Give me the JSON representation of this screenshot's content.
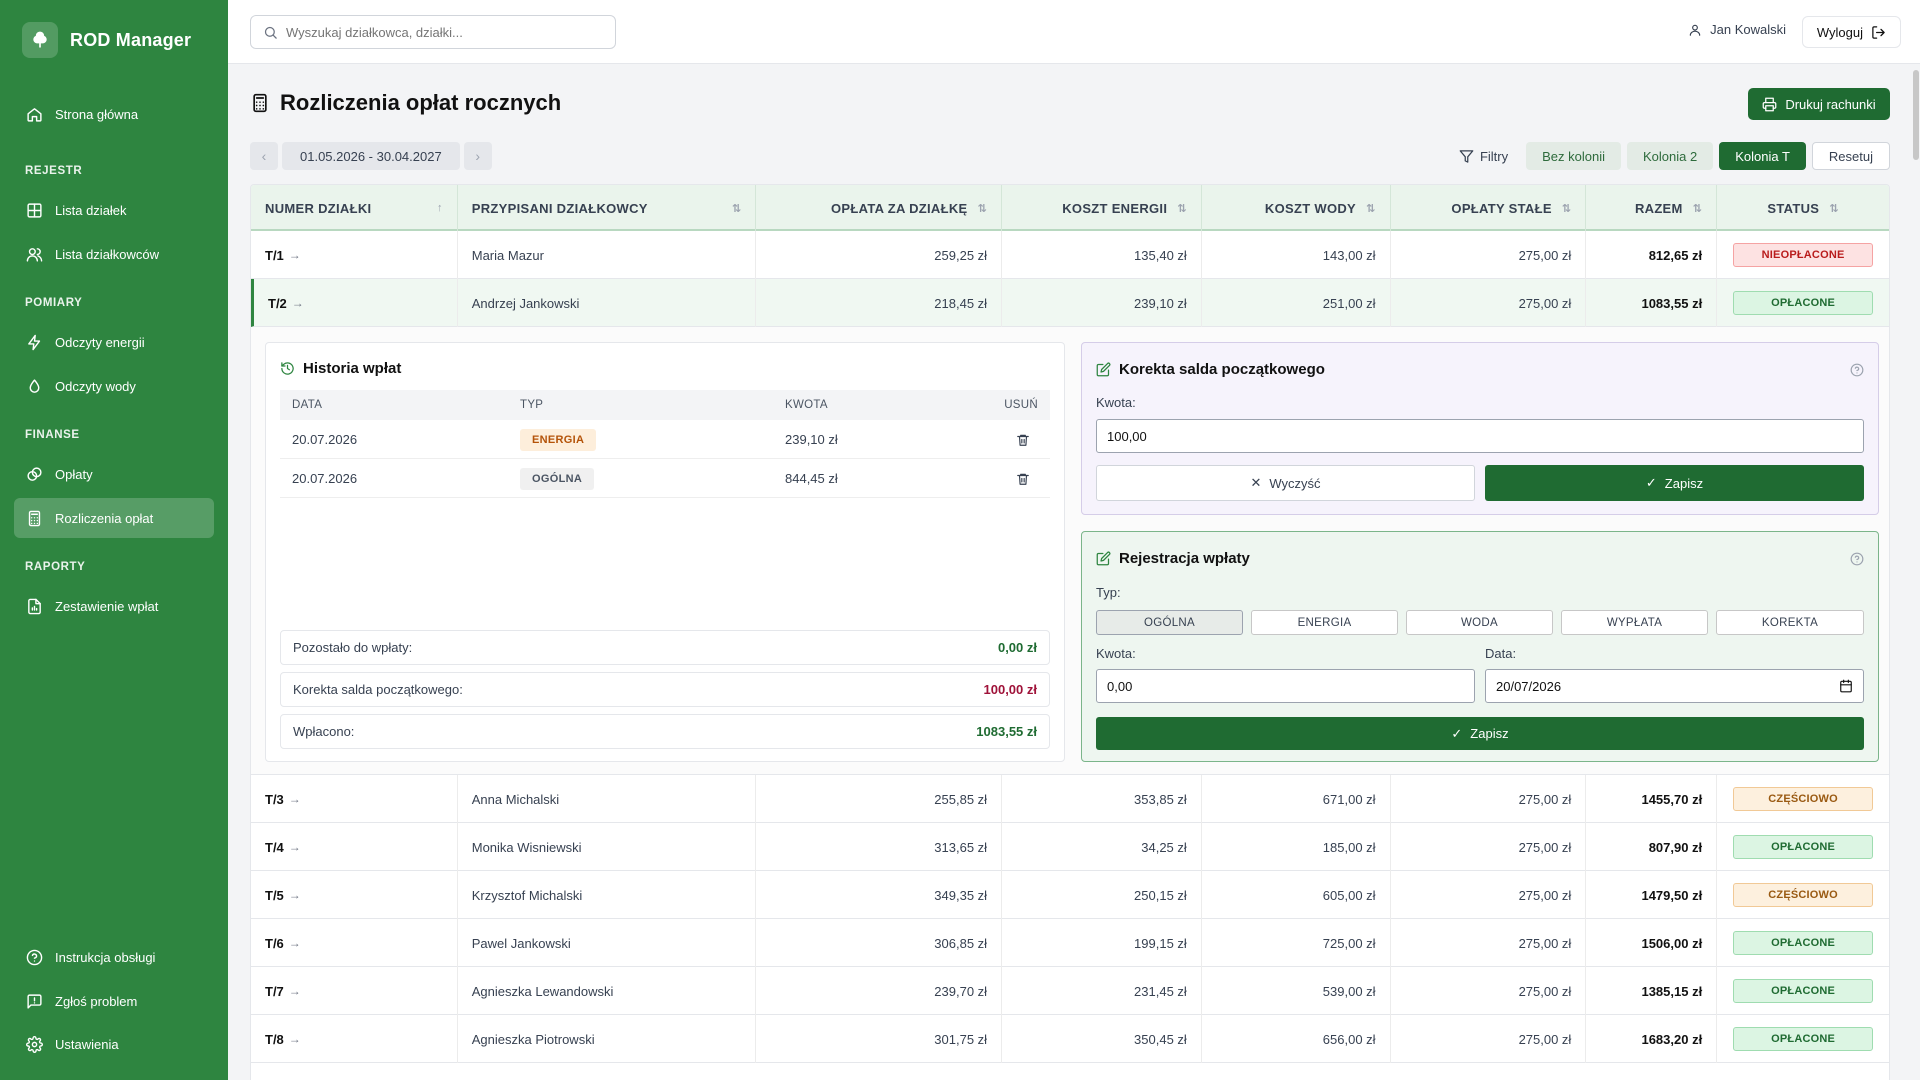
{
  "app": {
    "name": "ROD Manager"
  },
  "sidebar": {
    "home": "Strona główna",
    "sections": {
      "rejestr": "REJESTR",
      "pomiary": "POMIARY",
      "finanse": "FINANSE",
      "raporty": "RAPORTY"
    },
    "items": {
      "plots": "Lista działek",
      "members": "Lista działkowców",
      "energy": "Odczyty energii",
      "water": "Odczyty wody",
      "fees": "Opłaty",
      "settlements": "Rozliczenia opłat",
      "payments_report": "Zestawienie wpłat",
      "manual": "Instrukcja obsługi",
      "report_problem": "Zgłoś problem",
      "settings": "Ustawienia"
    }
  },
  "topbar": {
    "search_placeholder": "Wyszukaj działkowca, działki...",
    "user": "Jan Kowalski",
    "logout": "Wyloguj"
  },
  "page": {
    "title": "Rozliczenia opłat rocznych",
    "print_button": "Drukuj rachunki",
    "period": "01.05.2026 - 30.04.2027",
    "filters_label": "Filtry",
    "filter_chips": [
      "Bez kolonii",
      "Kolonia 2",
      "Kolonia T"
    ],
    "active_chip": "Kolonia T",
    "reset": "Resetuj"
  },
  "table": {
    "columns": [
      "NUMER DZIAŁKI",
      "PRZYPISANI DZIAŁKOWCY",
      "OPŁATA ZA DZIAŁKĘ",
      "KOSZT ENERGII",
      "KOSZT WODY",
      "OPŁATY STAŁE",
      "RAZEM",
      "STATUS"
    ],
    "rows": [
      {
        "plot": "T/1",
        "owner": "Maria Mazur",
        "plot_fee": "259,25 zł",
        "energy": "135,40 zł",
        "water": "143,00 zł",
        "fixed": "275,00 zł",
        "total": "812,65 zł",
        "status": "NIEOPŁACONE",
        "status_kind": "unpaid"
      },
      {
        "plot": "T/2",
        "owner": "Andrzej Jankowski",
        "plot_fee": "218,45 zł",
        "energy": "239,10 zł",
        "water": "251,00 zł",
        "fixed": "275,00 zł",
        "total": "1083,55 zł",
        "status": "OPŁACONE",
        "status_kind": "paid"
      },
      {
        "plot": "T/3",
        "owner": "Anna Michalski",
        "plot_fee": "255,85 zł",
        "energy": "353,85 zł",
        "water": "671,00 zł",
        "fixed": "275,00 zł",
        "total": "1455,70 zł",
        "status": "CZĘŚCIOWO",
        "status_kind": "partial"
      },
      {
        "plot": "T/4",
        "owner": "Monika Wisniewski",
        "plot_fee": "313,65 zł",
        "energy": "34,25 zł",
        "water": "185,00 zł",
        "fixed": "275,00 zł",
        "total": "807,90 zł",
        "status": "OPŁACONE",
        "status_kind": "paid"
      },
      {
        "plot": "T/5",
        "owner": "Krzysztof Michalski",
        "plot_fee": "349,35 zł",
        "energy": "250,15 zł",
        "water": "605,00 zł",
        "fixed": "275,00 zł",
        "total": "1479,50 zł",
        "status": "CZĘŚCIOWO",
        "status_kind": "partial"
      },
      {
        "plot": "T/6",
        "owner": "Pawel Jankowski",
        "plot_fee": "306,85 zł",
        "energy": "199,15 zł",
        "water": "725,00 zł",
        "fixed": "275,00 zł",
        "total": "1506,00 zł",
        "status": "OPŁACONE",
        "status_kind": "paid"
      },
      {
        "plot": "T/7",
        "owner": "Agnieszka Lewandowski",
        "plot_fee": "239,70 zł",
        "energy": "231,45 zł",
        "water": "539,00 zł",
        "fixed": "275,00 zł",
        "total": "1385,15 zł",
        "status": "OPŁACONE",
        "status_kind": "paid"
      },
      {
        "plot": "T/8",
        "owner": "Agnieszka Piotrowski",
        "plot_fee": "301,75 zł",
        "energy": "350,45 zł",
        "water": "656,00 zł",
        "fixed": "275,00 zł",
        "total": "1683,20 zł",
        "status": "OPŁACONE",
        "status_kind": "paid"
      }
    ]
  },
  "history": {
    "title": "Historia wpłat",
    "columns": [
      "DATA",
      "TYP",
      "KWOTA",
      "USUŃ"
    ],
    "rows": [
      {
        "date": "20.07.2026",
        "type": "ENERGIA",
        "amount": "239,10 zł"
      },
      {
        "date": "20.07.2026",
        "type": "OGÓLNA",
        "amount": "844,45 zł"
      }
    ],
    "remaining_label": "Pozostało do wpłaty:",
    "remaining_value": "0,00 zł",
    "correction_label": "Korekta salda początkowego:",
    "correction_value": "100,00 zł",
    "paid_label": "Wpłacono:",
    "paid_value": "1083,55 zł"
  },
  "correction": {
    "title": "Korekta salda początkowego",
    "amount_label": "Kwota:",
    "amount_value": "100,00",
    "clear": "Wyczyść",
    "save": "Zapisz"
  },
  "payment": {
    "title": "Rejestracja wpłaty",
    "type_label": "Typ:",
    "types": [
      "OGÓLNA",
      "ENERGIA",
      "WODA",
      "WYPŁATA",
      "KOREKTA"
    ],
    "selected_type": "OGÓLNA",
    "amount_label": "Kwota:",
    "amount_value": "0,00",
    "date_label": "Data:",
    "date_value": "20/07/2026",
    "save": "Zapisz"
  },
  "colors": {
    "sidebar": "#2e8540",
    "primary": "#1f6b32",
    "paid": "#1f6b32",
    "unpaid": "#b91c1c",
    "partial": "#9a5a12"
  }
}
